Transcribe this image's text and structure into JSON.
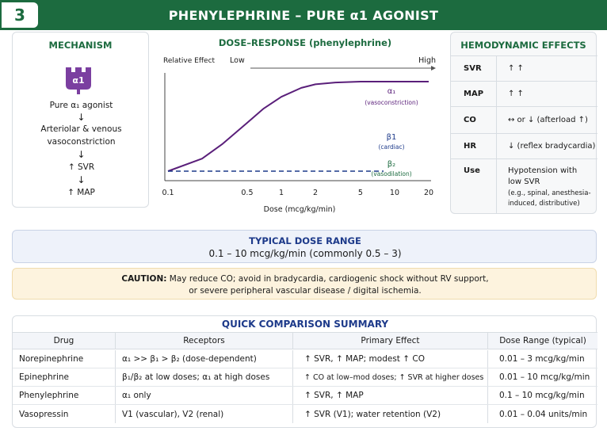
{
  "header": {
    "number": "3",
    "title": "PHENYLEPHRINE – PURE α1 AGONIST"
  },
  "mechanism": {
    "title": "MECHANISM",
    "receptor_label": "α1",
    "steps": [
      "Pure α₁ agonist",
      "Arteriolar & venous",
      "vasoconstriction",
      "↑ SVR",
      "↑ MAP"
    ],
    "arrow": "↓",
    "accent_color": "#7b3fa0"
  },
  "dose_response": {
    "title": "DOSE–RESPONSE (phenylephrine)",
    "top_label": "Relative Effect",
    "low_label": "Low",
    "high_label": "High",
    "x_axis_label": "Dose (mcg/kg/min)"
  },
  "chart_data": {
    "type": "line",
    "title": "DOSE–RESPONSE (phenylephrine)",
    "xlabel": "Dose (mcg/kg/min)",
    "ylabel": "Relative Effect",
    "x_scale": "log",
    "x_ticks": [
      "0.1",
      "0.5",
      "1",
      "2",
      "5",
      "10",
      "20"
    ],
    "xlim": [
      0.1,
      20
    ],
    "ylim": [
      0,
      1
    ],
    "series": [
      {
        "name": "α₁",
        "sublabel": "(vasoconstriction)",
        "color": "#5a1f7a",
        "style": "solid",
        "x": [
          0.1,
          0.2,
          0.3,
          0.5,
          0.7,
          1,
          1.5,
          2,
          3,
          5,
          10,
          20
        ],
        "y": [
          0.0,
          0.14,
          0.3,
          0.54,
          0.7,
          0.83,
          0.93,
          0.97,
          0.99,
          1.0,
          1.0,
          1.0
        ]
      },
      {
        "name": "β1",
        "sublabel": "(cardiac)",
        "color": "#1d3a8a",
        "style": "dashed",
        "x": [
          0.1,
          0.2,
          0.5,
          1,
          2,
          5,
          8
        ],
        "y": [
          0,
          0,
          0,
          0,
          0,
          0,
          0
        ]
      },
      {
        "name": "β₂",
        "sublabel": "(vasodilation)",
        "color": "#1c6b3f",
        "style": "none",
        "x": [],
        "y": []
      }
    ]
  },
  "hemodynamic": {
    "title": "HEMODYNAMIC EFFECTS",
    "rows": [
      {
        "key": "SVR",
        "value": "↑ ↑"
      },
      {
        "key": "MAP",
        "value": "↑ ↑"
      },
      {
        "key": "CO",
        "value": "↔ or ↓ (afterload ↑)"
      },
      {
        "key": "HR",
        "value": "↓ (reflex bradycardia)"
      }
    ],
    "use": {
      "key": "Use",
      "line1": "Hypotension with",
      "line2": "low SVR",
      "sub1": "(e.g., spinal, anesthesia-",
      "sub2": "induced, distributive)"
    }
  },
  "typical_dose": {
    "title": "TYPICAL DOSE RANGE",
    "value": "0.1 – 10 mcg/kg/min (commonly 0.5 – 3)"
  },
  "caution": {
    "label": "CAUTION:",
    "line1": "May reduce CO; avoid in bradycardia, cardiogenic shock without RV support,",
    "line2": "or severe peripheral vascular disease / digital ischemia."
  },
  "summary": {
    "title": "QUICK COMPARISON SUMMARY",
    "headers": [
      "Drug",
      "Receptors",
      "Primary Effect",
      "Dose Range (typical)"
    ],
    "rows": [
      [
        "Norepinephrine",
        "α₁ >> β₁ > β₂ (dose-dependent)",
        "↑ SVR, ↑ MAP; modest ↑ CO",
        "0.01 – 3 mcg/kg/min"
      ],
      [
        "Epinephrine",
        "β₁/β₂ at low doses; α₁ at high doses",
        "↑ CO at low–mod doses; ↑ SVR at higher doses",
        "0.01 – 10 mcg/kg/min"
      ],
      [
        "Phenylephrine",
        "α₁ only",
        "↑ SVR, ↑ MAP",
        "0.1 – 10 mcg/kg/min"
      ],
      [
        "Vasopressin",
        "V1 (vascular), V2 (renal)",
        "↑ SVR (V1); water retention (V2)",
        "0.01 – 0.04 units/min"
      ]
    ]
  }
}
